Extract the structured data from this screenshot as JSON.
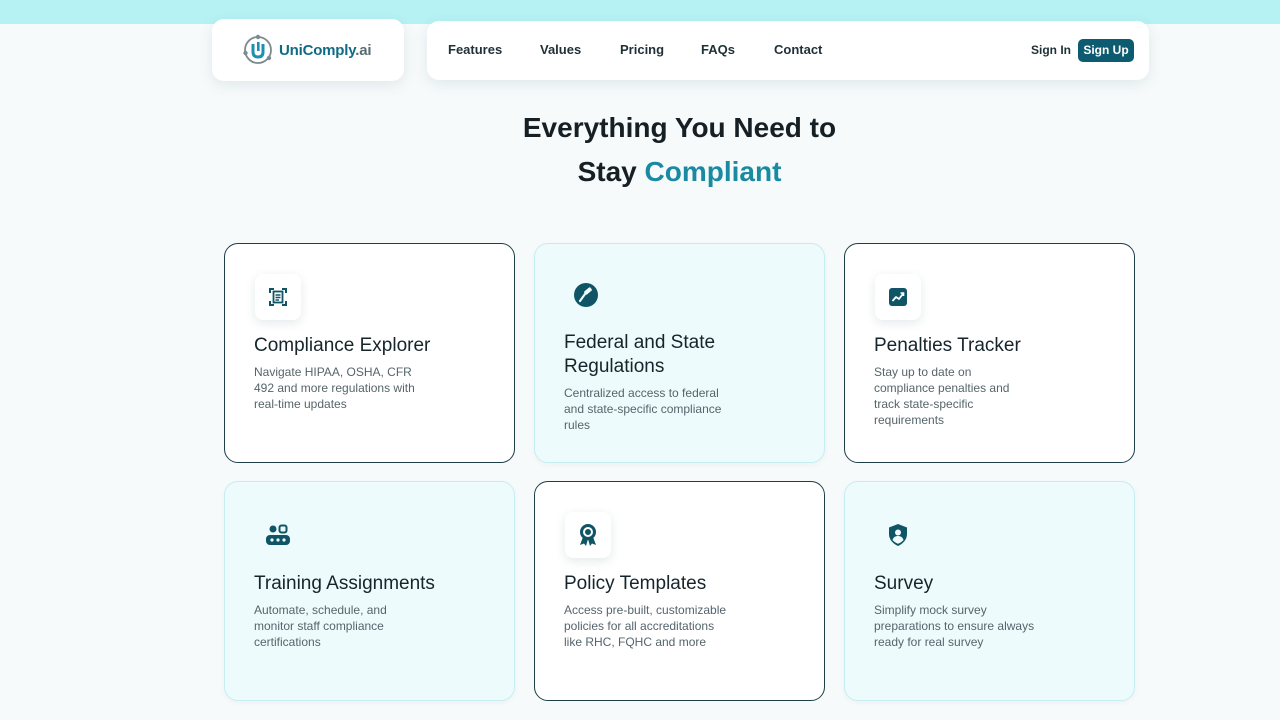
{
  "brand": {
    "name_part1": "UniComply",
    "name_part2": ".ai"
  },
  "nav": {
    "links": [
      "Features",
      "Values",
      "Pricing",
      "FAQs",
      "Contact"
    ],
    "signin": "Sign In",
    "signup": "Sign Up"
  },
  "hero": {
    "line1": "Everything You Need to",
    "line2_plain": "Stay ",
    "line2_accent": "Compliant"
  },
  "colors": {
    "accent": "#1a8aa3",
    "primary_dark": "#0d5b70",
    "card_tint": "#eefbfc"
  },
  "features": [
    {
      "title": "Compliance Explorer",
      "desc": "Navigate HIPAA, OSHA, CFR 492 and more regulations with real-time updates",
      "icon": "document-scan-icon"
    },
    {
      "title": "Federal and State Regulations",
      "desc": "Centralized access to federal and state-specific compliance rules",
      "icon": "gavel-icon"
    },
    {
      "title": "Penalties Tracker",
      "desc": "Stay up to date on compliance penalties and track state-specific requirements",
      "icon": "trend-chart-icon"
    },
    {
      "title": "Training Assignments",
      "desc": "Automate, schedule, and monitor staff compliance certifications",
      "icon": "group-icon"
    },
    {
      "title": "Policy Templates",
      "desc": "Access pre-built, customizable policies for all accreditations like RHC, FQHC and more",
      "icon": "award-badge-icon"
    },
    {
      "title": "Survey",
      "desc": "Simplify mock survey preparations to ensure always ready for real survey",
      "icon": "shield-user-icon"
    }
  ]
}
